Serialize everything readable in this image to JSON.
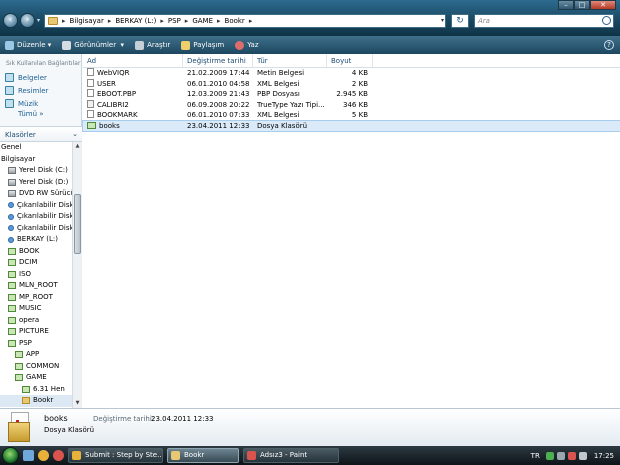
{
  "window_controls": {
    "minimize": "–",
    "maximize": "□",
    "close": "✕"
  },
  "address": {
    "crumbs": [
      "Bilgisayar",
      "BERKAY (L:)",
      "PSP",
      "GAME",
      "Bookr"
    ],
    "refresh_icon": "refresh-icon",
    "search_placeholder": "Ara"
  },
  "toolbar": {
    "organize": "Düzenle",
    "views": "Görünümler",
    "explore": "Araştır",
    "share": "Paylaşım",
    "burn": "Yaz",
    "help": "?"
  },
  "sidebar": {
    "favorites_heading": "Sık Kullanılan Bağlantılar",
    "favorites": [
      "Belgeler",
      "Resimler",
      "Müzik"
    ],
    "more": "Tümü",
    "folders_heading": "Klasörler",
    "tree": [
      {
        "label": "Genel",
        "icon": "none",
        "indent": 0
      },
      {
        "label": "Bilgisayar",
        "icon": "none",
        "indent": 0
      },
      {
        "label": "Yerel Disk (C:)",
        "icon": "drive",
        "indent": 1
      },
      {
        "label": "Yerel Disk (D:)",
        "icon": "drive",
        "indent": 1
      },
      {
        "label": "DVD RW Sürücüsü (E:)",
        "icon": "drive",
        "indent": 1
      },
      {
        "label": "Çıkarılabilir Disk (G:)",
        "icon": "blue",
        "indent": 1
      },
      {
        "label": "Çıkarılabilir Disk (H:)",
        "icon": "blue",
        "indent": 1
      },
      {
        "label": "Çıkarılabilir Disk (I:)",
        "icon": "blue",
        "indent": 1
      },
      {
        "label": "BERKAY (L:)",
        "icon": "blue",
        "indent": 1
      },
      {
        "label": "BOOK",
        "icon": "folder",
        "indent": 1
      },
      {
        "label": "DCIM",
        "icon": "folder",
        "indent": 1
      },
      {
        "label": "ISO",
        "icon": "folder",
        "indent": 1
      },
      {
        "label": "MLN_ROOT",
        "icon": "folder",
        "indent": 1
      },
      {
        "label": "MP_ROOT",
        "icon": "folder",
        "indent": 1
      },
      {
        "label": "MUSIC",
        "icon": "folder",
        "indent": 1
      },
      {
        "label": "opera",
        "icon": "folder",
        "indent": 1
      },
      {
        "label": "PICTURE",
        "icon": "folder",
        "indent": 1
      },
      {
        "label": "PSP",
        "icon": "folder",
        "indent": 1
      },
      {
        "label": "APP",
        "icon": "folder",
        "indent": 2
      },
      {
        "label": "COMMON",
        "icon": "folder",
        "indent": 2
      },
      {
        "label": "GAME",
        "icon": "folder",
        "indent": 2
      },
      {
        "label": "6.31 Hen",
        "icon": "folder",
        "indent": 3
      },
      {
        "label": "Bookr",
        "icon": "open",
        "indent": 3,
        "selected": true
      }
    ]
  },
  "list": {
    "columns": [
      "Ad",
      "Değiştirme tarihi",
      "Tür",
      "Boyut"
    ],
    "rows": [
      {
        "name": "WebVIQR",
        "date": "21.02.2009 17:44",
        "type": "Metin Belgesi",
        "size": "4 KB",
        "icon": "doc"
      },
      {
        "name": "USER",
        "date": "06.01.2010 04:58",
        "type": "XML Belgesi",
        "size": "2 KB",
        "icon": "doc"
      },
      {
        "name": "EBOOT.PBP",
        "date": "12.03.2009 21:43",
        "type": "PBP Dosyası",
        "size": "2.945 KB",
        "icon": "doc"
      },
      {
        "name": "CALIBRI2",
        "date": "06.09.2008 20:22",
        "type": "TrueType Yazı Tipi...",
        "size": "346 KB",
        "icon": "ttf"
      },
      {
        "name": "BOOKMARK",
        "date": "06.01.2010 07:33",
        "type": "XML Belgesi",
        "size": "5 KB",
        "icon": "doc"
      },
      {
        "name": "books",
        "date": "23.04.2011 12:33",
        "type": "Dosya Klasörü",
        "size": "",
        "icon": "folder",
        "selected": true
      }
    ]
  },
  "details": {
    "name": "books",
    "date_label": "Değiştirme tarihi:",
    "date_value": "23.04.2011 12:33",
    "type": "Dosya Klasörü"
  },
  "taskbar": {
    "buttons": [
      {
        "label": "Submit : Step by Ste...",
        "active": false,
        "icon_color": "#e8b23a"
      },
      {
        "label": "Bookr",
        "active": true,
        "icon_color": "#e8c872"
      },
      {
        "label": "Adsız3 - Paint",
        "active": false,
        "icon_color": "#d9534f"
      }
    ],
    "lang": "TR",
    "clock": "17:25"
  },
  "colors": {
    "accent": "#1b4b74",
    "link": "#1a5e94",
    "selection": "#dbeaf9"
  }
}
